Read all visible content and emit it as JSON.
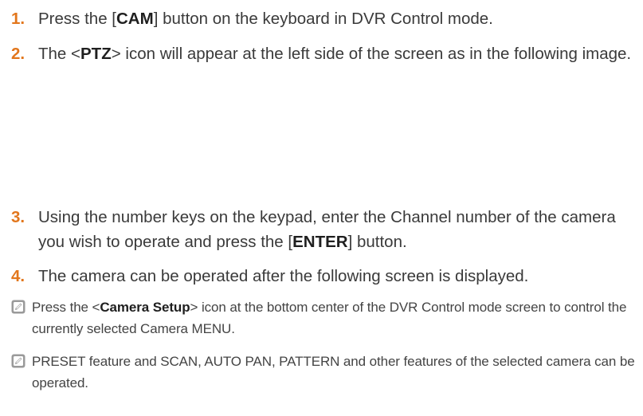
{
  "steps": [
    {
      "number": "1.",
      "pre": "Press the [",
      "bold": "CAM",
      "post": "] button on the keyboard in DVR Control mode."
    },
    {
      "number": "2.",
      "pre": "The <",
      "bold": "PTZ",
      "post": "> icon will appear at the left side of the screen as in the following image."
    },
    {
      "number": "3.",
      "pre": "Using the number keys on the keypad, enter the Channel number of the camera you wish to operate and press the [",
      "bold": "ENTER",
      "post": "] button."
    },
    {
      "number": "4.",
      "text": "The camera can be operated after the following screen is displayed."
    }
  ],
  "notes": [
    {
      "icon": "note-pencil-icon",
      "pre": "Press the <",
      "bold": "Camera Setup",
      "post": "> icon at the bottom center of the DVR Control mode screen to control the currently selected Camera MENU."
    },
    {
      "icon": "note-pencil-icon",
      "text": "PRESET feature and SCAN, AUTO PAN, PATTERN and other features of the selected camera can be operated."
    }
  ],
  "colors": {
    "step_number": "#e2761c",
    "body_text": "#3a3a3a",
    "note_icon": "#9a9a9a"
  }
}
